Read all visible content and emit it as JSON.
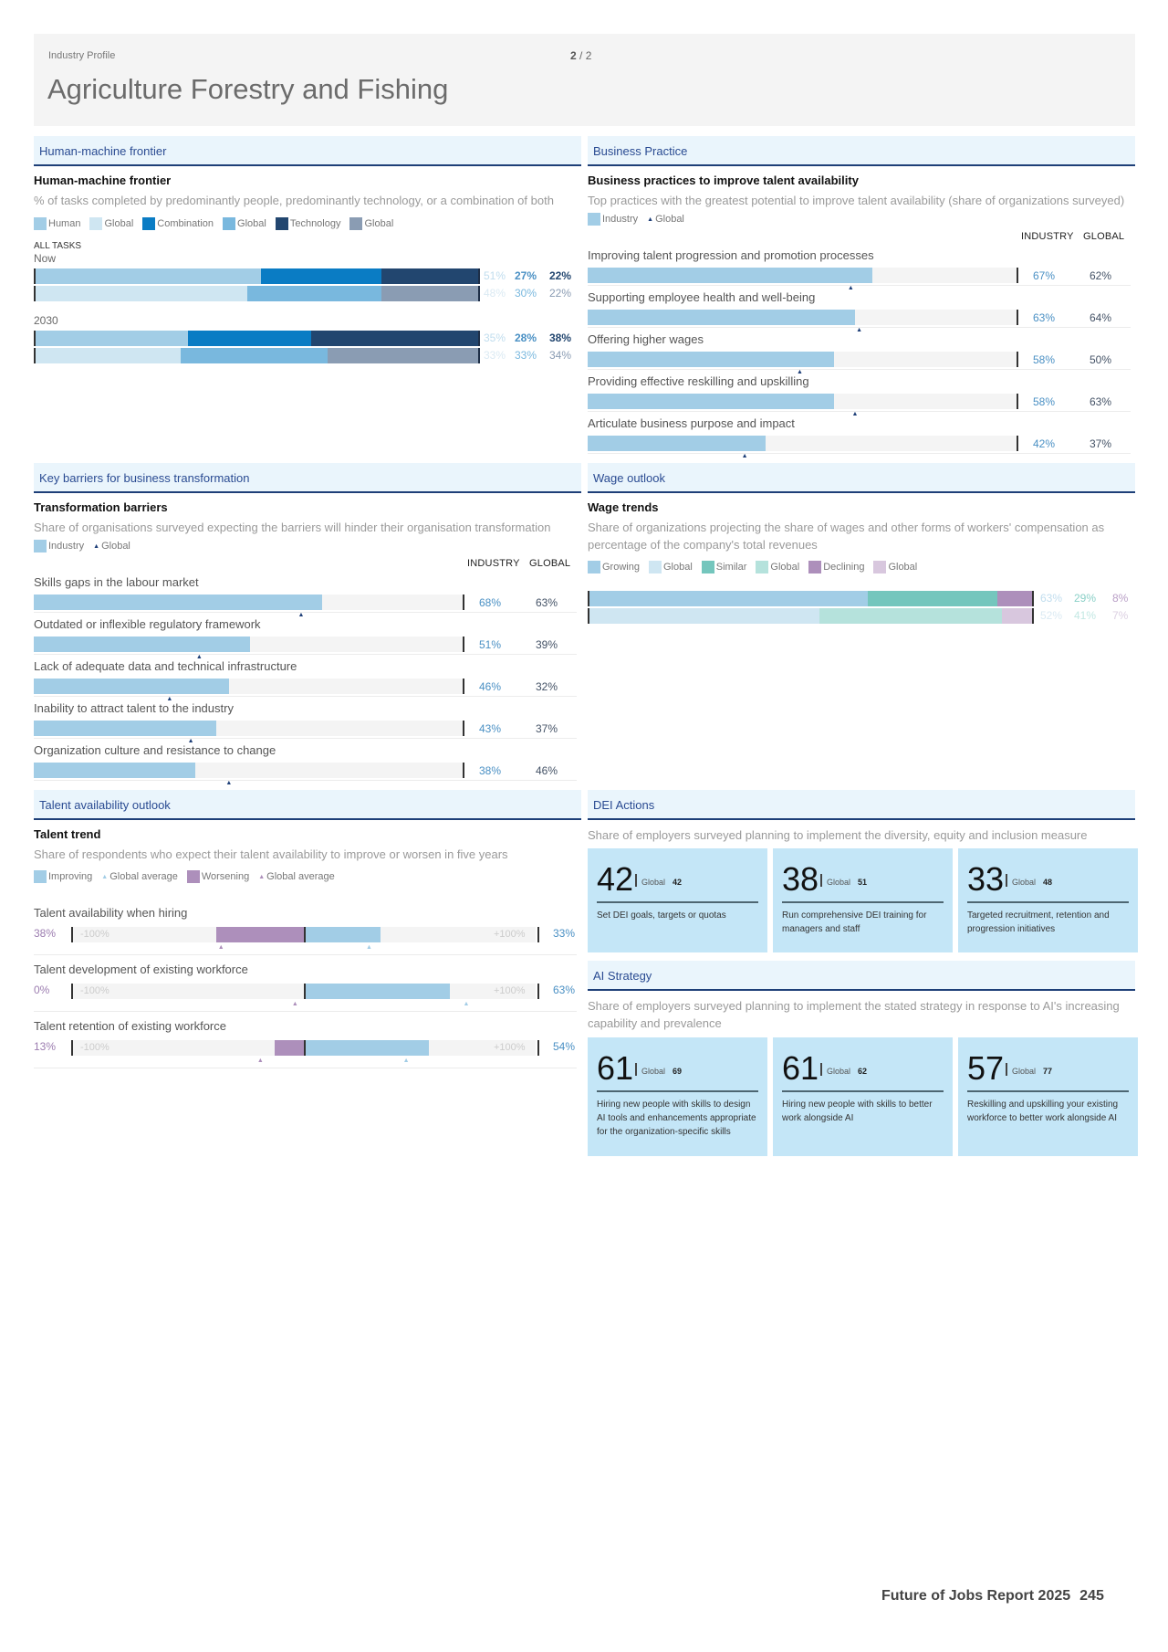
{
  "header": {
    "eyebrow": "Industry Profile",
    "page_current": "2",
    "page_sep": " / ",
    "page_total": "2",
    "title": "Agriculture Forestry and Fishing"
  },
  "hmf": {
    "section": "Human-machine frontier",
    "title": "Human-machine frontier",
    "subtitle": "% of tasks completed by predominantly people, predominantly technology, or a combination of both",
    "legend": [
      {
        "label": "Human",
        "color": "#a2cde6"
      },
      {
        "label": "Global",
        "color": "#cfe6f2"
      },
      {
        "label": "Combination",
        "color": "#0a7cc4"
      },
      {
        "label": "Global",
        "color": "#79b8de"
      },
      {
        "label": "Technology",
        "color": "#22466f"
      },
      {
        "label": "Global",
        "color": "#8a9cb3"
      }
    ],
    "all_tasks": "ALL TASKS",
    "groups": [
      {
        "label": "Now",
        "industry": {
          "human": 51,
          "combination": 27,
          "technology": 22,
          "labels": [
            "51%",
            "27%",
            "22%"
          ]
        },
        "global": {
          "human": 48,
          "combination": 30,
          "technology": 22,
          "labels": [
            "48%",
            "30%",
            "22%"
          ]
        }
      },
      {
        "label": "2030",
        "industry": {
          "human": 35,
          "combination": 28,
          "technology": 38,
          "labels": [
            "35%",
            "28%",
            "38%"
          ]
        },
        "global": {
          "human": 33,
          "combination": 33,
          "technology": 34,
          "labels": [
            "33%",
            "33%",
            "34%"
          ]
        }
      }
    ]
  },
  "bp": {
    "section": "Business Practice",
    "title": "Business practices to improve talent availability",
    "subtitle": "Top practices with the greatest potential to improve talent availability (share of organizations surveyed)",
    "legend_industry": "Industry",
    "legend_global": "Global",
    "col_industry": "INDUSTRY",
    "col_global": "GLOBAL",
    "rows": [
      {
        "label": "Improving talent progression and promotion processes",
        "industry": 67,
        "global": 62,
        "industry_label": "67%",
        "global_label": "62%"
      },
      {
        "label": "Supporting employee health and well-being",
        "industry": 63,
        "global": 64,
        "industry_label": "63%",
        "global_label": "64%"
      },
      {
        "label": "Offering higher wages",
        "industry": 58,
        "global": 50,
        "industry_label": "58%",
        "global_label": "50%"
      },
      {
        "label": "Providing effective reskilling and upskilling",
        "industry": 58,
        "global": 63,
        "industry_label": "58%",
        "global_label": "63%"
      },
      {
        "label": "Articulate business purpose and impact",
        "industry": 42,
        "global": 37,
        "industry_label": "42%",
        "global_label": "37%"
      }
    ]
  },
  "kb": {
    "section": "Key barriers for business transformation",
    "title": "Transformation barriers",
    "subtitle": "Share of organisations surveyed expecting the barriers will hinder their organisation transformation",
    "legend_industry": "Industry",
    "legend_global": "Global",
    "col_industry": "INDUSTRY",
    "col_global": "GLOBAL",
    "rows": [
      {
        "label": "Skills gaps in the labour market",
        "industry": 68,
        "global": 63,
        "industry_label": "68%",
        "global_label": "63%"
      },
      {
        "label": "Outdated or inflexible regulatory framework",
        "industry": 51,
        "global": 39,
        "industry_label": "51%",
        "global_label": "39%"
      },
      {
        "label": "Lack of adequate data and technical infrastructure",
        "industry": 46,
        "global": 32,
        "industry_label": "46%",
        "global_label": "32%"
      },
      {
        "label": "Inability to attract talent to the industry",
        "industry": 43,
        "global": 37,
        "industry_label": "43%",
        "global_label": "37%"
      },
      {
        "label": "Organization culture and resistance to change",
        "industry": 38,
        "global": 46,
        "industry_label": "38%",
        "global_label": "46%"
      }
    ]
  },
  "wage": {
    "section": "Wage outlook",
    "title": "Wage trends",
    "subtitle": "Share of organizations projecting the share of wages and other forms of workers' compensation as percentage of the company's total revenues",
    "legend": [
      {
        "label": "Growing",
        "color": "#a2cde6"
      },
      {
        "label": "Global",
        "color": "#cfe6f2"
      },
      {
        "label": "Similar",
        "color": "#74c6bd"
      },
      {
        "label": "Global",
        "color": "#b5e2dc"
      },
      {
        "label": "Declining",
        "color": "#ad8fbb"
      },
      {
        "label": "Global",
        "color": "#d8c7de"
      }
    ],
    "industry": {
      "growing": 63,
      "similar": 29,
      "declining": 8,
      "labels": [
        "63%",
        "29%",
        "8%"
      ]
    },
    "global": {
      "growing": 52,
      "similar": 41,
      "declining": 7,
      "labels": [
        "52%",
        "41%",
        "7%"
      ]
    }
  },
  "talent": {
    "section": "Talent availability outlook",
    "title": "Talent trend",
    "subtitle": "Share of respondents who expect their talent availability to improve or worsen in five years",
    "legend": [
      "Improving",
      "Global average",
      "Worsening",
      "Global average"
    ],
    "axis_min": "-100%",
    "axis_max": "+100%",
    "rows": [
      {
        "label": "Talent availability when hiring",
        "worsening": 38,
        "improving": 33,
        "global_worsening": 36,
        "global_improving": 28,
        "worsening_label": "38%",
        "improving_label": "33%"
      },
      {
        "label": "Talent development of existing workforce",
        "worsening": 0,
        "improving": 63,
        "global_worsening": 4,
        "global_improving": 70,
        "worsening_label": "0%",
        "improving_label": "63%"
      },
      {
        "label": "Talent retention of existing workforce",
        "worsening": 13,
        "improving": 54,
        "global_worsening": 19,
        "global_improving": 44,
        "worsening_label": "13%",
        "improving_label": "54%"
      }
    ]
  },
  "dei": {
    "section": "DEI Actions",
    "subtitle": "Share of employers surveyed planning to implement the diversity, equity and inclusion measure",
    "cards": [
      {
        "value": "42",
        "global_label": "Global",
        "global_value": "42",
        "desc": "Set DEI goals, targets or quotas"
      },
      {
        "value": "38",
        "global_label": "Global",
        "global_value": "51",
        "desc": "Run comprehensive DEI training for managers and staff"
      },
      {
        "value": "33",
        "global_label": "Global",
        "global_value": "48",
        "desc": "Targeted recruitment, retention and progression initiatives"
      }
    ]
  },
  "ai": {
    "section": "AI Strategy",
    "subtitle": "Share of employers surveyed planning to implement the stated strategy in response to AI's increasing capability and prevalence",
    "cards": [
      {
        "value": "61",
        "global_label": "Global",
        "global_value": "69",
        "desc": "Hiring new people with skills to design AI tools and enhancements appropriate for the organization-specific skills"
      },
      {
        "value": "61",
        "global_label": "Global",
        "global_value": "62",
        "desc": "Hiring new people with skills to better work alongside AI"
      },
      {
        "value": "57",
        "global_label": "Global",
        "global_value": "77",
        "desc": "Reskilling and upskilling your existing workforce to better work alongside AI"
      }
    ]
  },
  "footer": {
    "report": "Future of Jobs Report 2025",
    "page": "245"
  },
  "chart_data": [
    {
      "type": "bar",
      "title": "Human-machine frontier",
      "categories": [
        "Now",
        "2030"
      ],
      "series": [
        {
          "name": "Human (Industry)",
          "values": [
            51,
            35
          ]
        },
        {
          "name": "Combination (Industry)",
          "values": [
            27,
            28
          ]
        },
        {
          "name": "Technology (Industry)",
          "values": [
            22,
            38
          ]
        },
        {
          "name": "Human (Global)",
          "values": [
            48,
            33
          ]
        },
        {
          "name": "Combination (Global)",
          "values": [
            30,
            33
          ]
        },
        {
          "name": "Technology (Global)",
          "values": [
            22,
            34
          ]
        }
      ],
      "stacked": true,
      "orientation": "horizontal",
      "unit": "%"
    },
    {
      "type": "bar",
      "title": "Business practices to improve talent availability",
      "categories": [
        "Improving talent progression and promotion processes",
        "Supporting employee health and well-being",
        "Offering higher wages",
        "Providing effective reskilling and upskilling",
        "Articulate business purpose and impact"
      ],
      "series": [
        {
          "name": "Industry",
          "values": [
            67,
            63,
            58,
            58,
            42
          ]
        },
        {
          "name": "Global",
          "values": [
            62,
            64,
            50,
            63,
            37
          ]
        }
      ],
      "orientation": "horizontal",
      "xlim": [
        0,
        100
      ],
      "unit": "%"
    },
    {
      "type": "bar",
      "title": "Transformation barriers",
      "categories": [
        "Skills gaps in the labour market",
        "Outdated or inflexible regulatory framework",
        "Lack of adequate data and technical infrastructure",
        "Inability to attract talent to the industry",
        "Organization culture and resistance to change"
      ],
      "series": [
        {
          "name": "Industry",
          "values": [
            68,
            51,
            46,
            43,
            38
          ]
        },
        {
          "name": "Global",
          "values": [
            63,
            39,
            32,
            37,
            46
          ]
        }
      ],
      "orientation": "horizontal",
      "xlim": [
        0,
        100
      ],
      "unit": "%"
    },
    {
      "type": "bar",
      "title": "Wage trends",
      "categories": [
        "Industry",
        "Global"
      ],
      "series": [
        {
          "name": "Growing",
          "values": [
            63,
            52
          ]
        },
        {
          "name": "Similar",
          "values": [
            29,
            41
          ]
        },
        {
          "name": "Declining",
          "values": [
            8,
            7
          ]
        }
      ],
      "stacked": true,
      "orientation": "horizontal",
      "unit": "%"
    },
    {
      "type": "bar",
      "title": "Talent trend",
      "categories": [
        "Talent availability when hiring",
        "Talent development of existing workforce",
        "Talent retention of existing workforce"
      ],
      "series": [
        {
          "name": "Worsening",
          "values": [
            -38,
            0,
            -13
          ]
        },
        {
          "name": "Improving",
          "values": [
            33,
            63,
            54
          ]
        }
      ],
      "orientation": "horizontal",
      "xlim": [
        -100,
        100
      ],
      "unit": "%"
    }
  ]
}
